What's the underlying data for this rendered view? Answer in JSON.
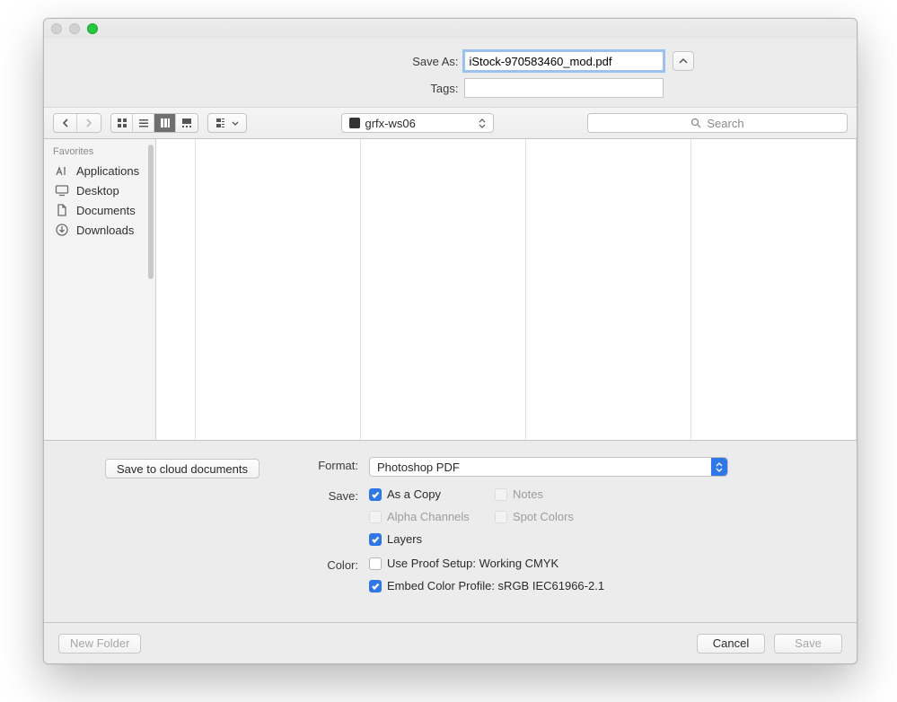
{
  "header": {
    "save_as_label": "Save As:",
    "filename": "iStock-970583460_mod.pdf",
    "tags_label": "Tags:",
    "tags_value": ""
  },
  "toolbar": {
    "location": "grfx-ws06",
    "search_placeholder": "Search"
  },
  "sidebar": {
    "heading": "Favorites",
    "items": [
      {
        "label": "Applications",
        "icon": "apps"
      },
      {
        "label": "Desktop",
        "icon": "desktop"
      },
      {
        "label": "Documents",
        "icon": "documents"
      },
      {
        "label": "Downloads",
        "icon": "downloads"
      }
    ]
  },
  "options": {
    "cloud_button": "Save to cloud documents",
    "format_label": "Format:",
    "format_value": "Photoshop PDF",
    "save_label": "Save:",
    "save_checks": {
      "as_a_copy": {
        "label": "As a Copy",
        "checked": true,
        "disabled": false
      },
      "notes": {
        "label": "Notes",
        "checked": false,
        "disabled": true
      },
      "alpha_channels": {
        "label": "Alpha Channels",
        "checked": false,
        "disabled": true
      },
      "spot_colors": {
        "label": "Spot Colors",
        "checked": false,
        "disabled": true
      },
      "layers": {
        "label": "Layers",
        "checked": true,
        "disabled": false
      }
    },
    "color_label": "Color:",
    "color_checks": {
      "use_proof": {
        "label": "Use Proof Setup:  Working CMYK",
        "checked": false,
        "disabled": false
      },
      "embed_profile": {
        "label": "Embed Color Profile:  sRGB IEC61966-2.1",
        "checked": true,
        "disabled": false
      }
    }
  },
  "footer": {
    "new_folder": "New Folder",
    "cancel": "Cancel",
    "save": "Save"
  }
}
